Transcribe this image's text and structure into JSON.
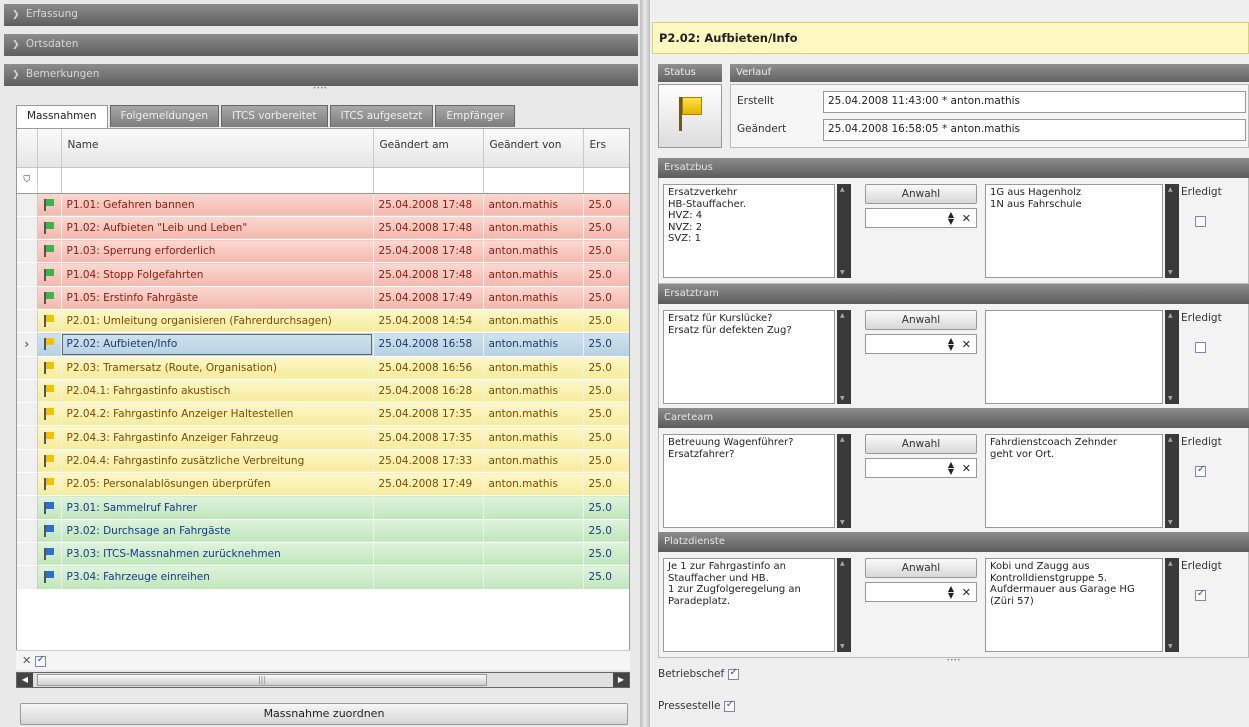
{
  "left": {
    "sections": [
      "Erfassung",
      "Ortsdaten",
      "Bemerkungen"
    ],
    "tabs": [
      "Massnahmen",
      "Folgemeldungen",
      "ITCS vorbereitet",
      "ITCS aufgesetzt",
      "Empfänger"
    ],
    "columns": [
      "Name",
      "Geändert am",
      "Geändert von",
      "Ers"
    ],
    "rows": [
      {
        "flag": "green",
        "color": "red",
        "name": "P1.01: Gefahren bannen",
        "date": "25.04.2008 17:48",
        "user": "anton.mathis",
        "ers": "25.0"
      },
      {
        "flag": "green",
        "color": "red",
        "name": "P1.02: Aufbieten \"Leib und Leben\"",
        "date": "25.04.2008 17:48",
        "user": "anton.mathis",
        "ers": "25.0"
      },
      {
        "flag": "green",
        "color": "red",
        "name": "P1.03: Sperrung erforderlich",
        "date": "25.04.2008 17:48",
        "user": "anton.mathis",
        "ers": "25.0"
      },
      {
        "flag": "green",
        "color": "red",
        "name": "P1.04: Stopp Folgefahrten",
        "date": "25.04.2008 17:48",
        "user": "anton.mathis",
        "ers": "25.0"
      },
      {
        "flag": "green",
        "color": "red",
        "name": "P1.05: Erstinfo Fahrgäste",
        "date": "25.04.2008 17:49",
        "user": "anton.mathis",
        "ers": "25.0"
      },
      {
        "flag": "yellow",
        "color": "yellow",
        "name": "P2.01: Umleitung organisieren (Fahrerdurchsagen)",
        "date": "25.04.2008 14:54",
        "user": "anton.mathis",
        "ers": "25.0"
      },
      {
        "flag": "yellow",
        "color": "current",
        "name": "P2.02: Aufbieten/Info",
        "date": "25.04.2008 16:58",
        "user": "anton.mathis",
        "ers": "25.0"
      },
      {
        "flag": "yellow",
        "color": "yellow",
        "name": "P2.03: Tramersatz (Route, Organisation)",
        "date": "25.04.2008 16:56",
        "user": "anton.mathis",
        "ers": "25.0"
      },
      {
        "flag": "yellow",
        "color": "yellow",
        "name": "P2.04.1: Fahrgastinfo akustisch",
        "date": "25.04.2008 16:28",
        "user": "anton.mathis",
        "ers": "25.0"
      },
      {
        "flag": "yellow",
        "color": "yellow",
        "name": "P2.04.2: Fahrgastinfo Anzeiger Haltestellen",
        "date": "25.04.2008 17:35",
        "user": "anton.mathis",
        "ers": "25.0"
      },
      {
        "flag": "yellow",
        "color": "yellow",
        "name": "P2.04.3: Fahrgastinfo Anzeiger Fahrzeug",
        "date": "25.04.2008 17:35",
        "user": "anton.mathis",
        "ers": "25.0"
      },
      {
        "flag": "yellow",
        "color": "yellow",
        "name": "P2.04.4: Fahrgastinfo zusätzliche Verbreitung",
        "date": "25.04.2008 17:33",
        "user": "anton.mathis",
        "ers": "25.0"
      },
      {
        "flag": "yellow",
        "color": "yellow",
        "name": "P2.05: Personalablösungen überprüfen",
        "date": "25.04.2008 17:49",
        "user": "anton.mathis",
        "ers": "25.0"
      },
      {
        "flag": "blue",
        "color": "green",
        "name": "P3.01: Sammelruf Fahrer",
        "date": "",
        "user": "",
        "ers": "25.0"
      },
      {
        "flag": "blue",
        "color": "green",
        "name": "P3.02: Durchsage an Fahrgäste",
        "date": "",
        "user": "",
        "ers": "25.0"
      },
      {
        "flag": "blue",
        "color": "green",
        "name": "P3.03: ITCS-Massnahmen zurücknehmen",
        "date": "",
        "user": "",
        "ers": "25.0"
      },
      {
        "flag": "blue",
        "color": "green",
        "name": "P3.04: Fahrzeuge einreihen",
        "date": "",
        "user": "",
        "ers": "25.0"
      }
    ],
    "filter_symbol": "✕",
    "assign_button": "Massnahme zuordnen"
  },
  "right": {
    "title": "P2.02: Aufbieten/Info",
    "status_label": "Status",
    "verlauf_label": "Verlauf",
    "created_label": "Erstellt",
    "created_value": "25.04.2008 11:43:00 * anton.mathis",
    "changed_label": "Geändert",
    "changed_value": "25.04.2008 16:58:05 * anton.mathis",
    "anwahl_label": "Anwahl",
    "erledigt_label": "Erledigt",
    "sections": [
      {
        "title": "Ersatzbus",
        "left_text": "Ersatzverkehr\nHB-Stauffacher.\nHVZ: 4\nNVZ: 2\nSVZ: 1",
        "right_text": "1G aus Hagenholz\n1N aus Fahrschule",
        "done": false
      },
      {
        "title": "Ersatztram",
        "left_text": "Ersatz für Kurslücke?\nErsatz für defekten Zug?",
        "right_text": "",
        "done": false
      },
      {
        "title": "Careteam",
        "left_text": "Betreuung Wagenführer?\nErsatzfahrer?",
        "right_text": "Fahrdienstcoach Zehnder\ngeht vor Ort.",
        "done": true
      },
      {
        "title": "Platzdienste",
        "left_text": "Je 1 zur Fahrgastinfo an\nStauffacher und HB.\n1 zur Zugfolgeregelung an\nParadeplatz.",
        "right_text": "Kobi und Zaugg aus\nKontrolldienstgruppe 5.\nAufdermauer aus Garage HG\n(Züri 57)",
        "done": true
      }
    ],
    "betriebschef_label": "Betriebschef",
    "pressestelle_label": "Pressestelle"
  }
}
